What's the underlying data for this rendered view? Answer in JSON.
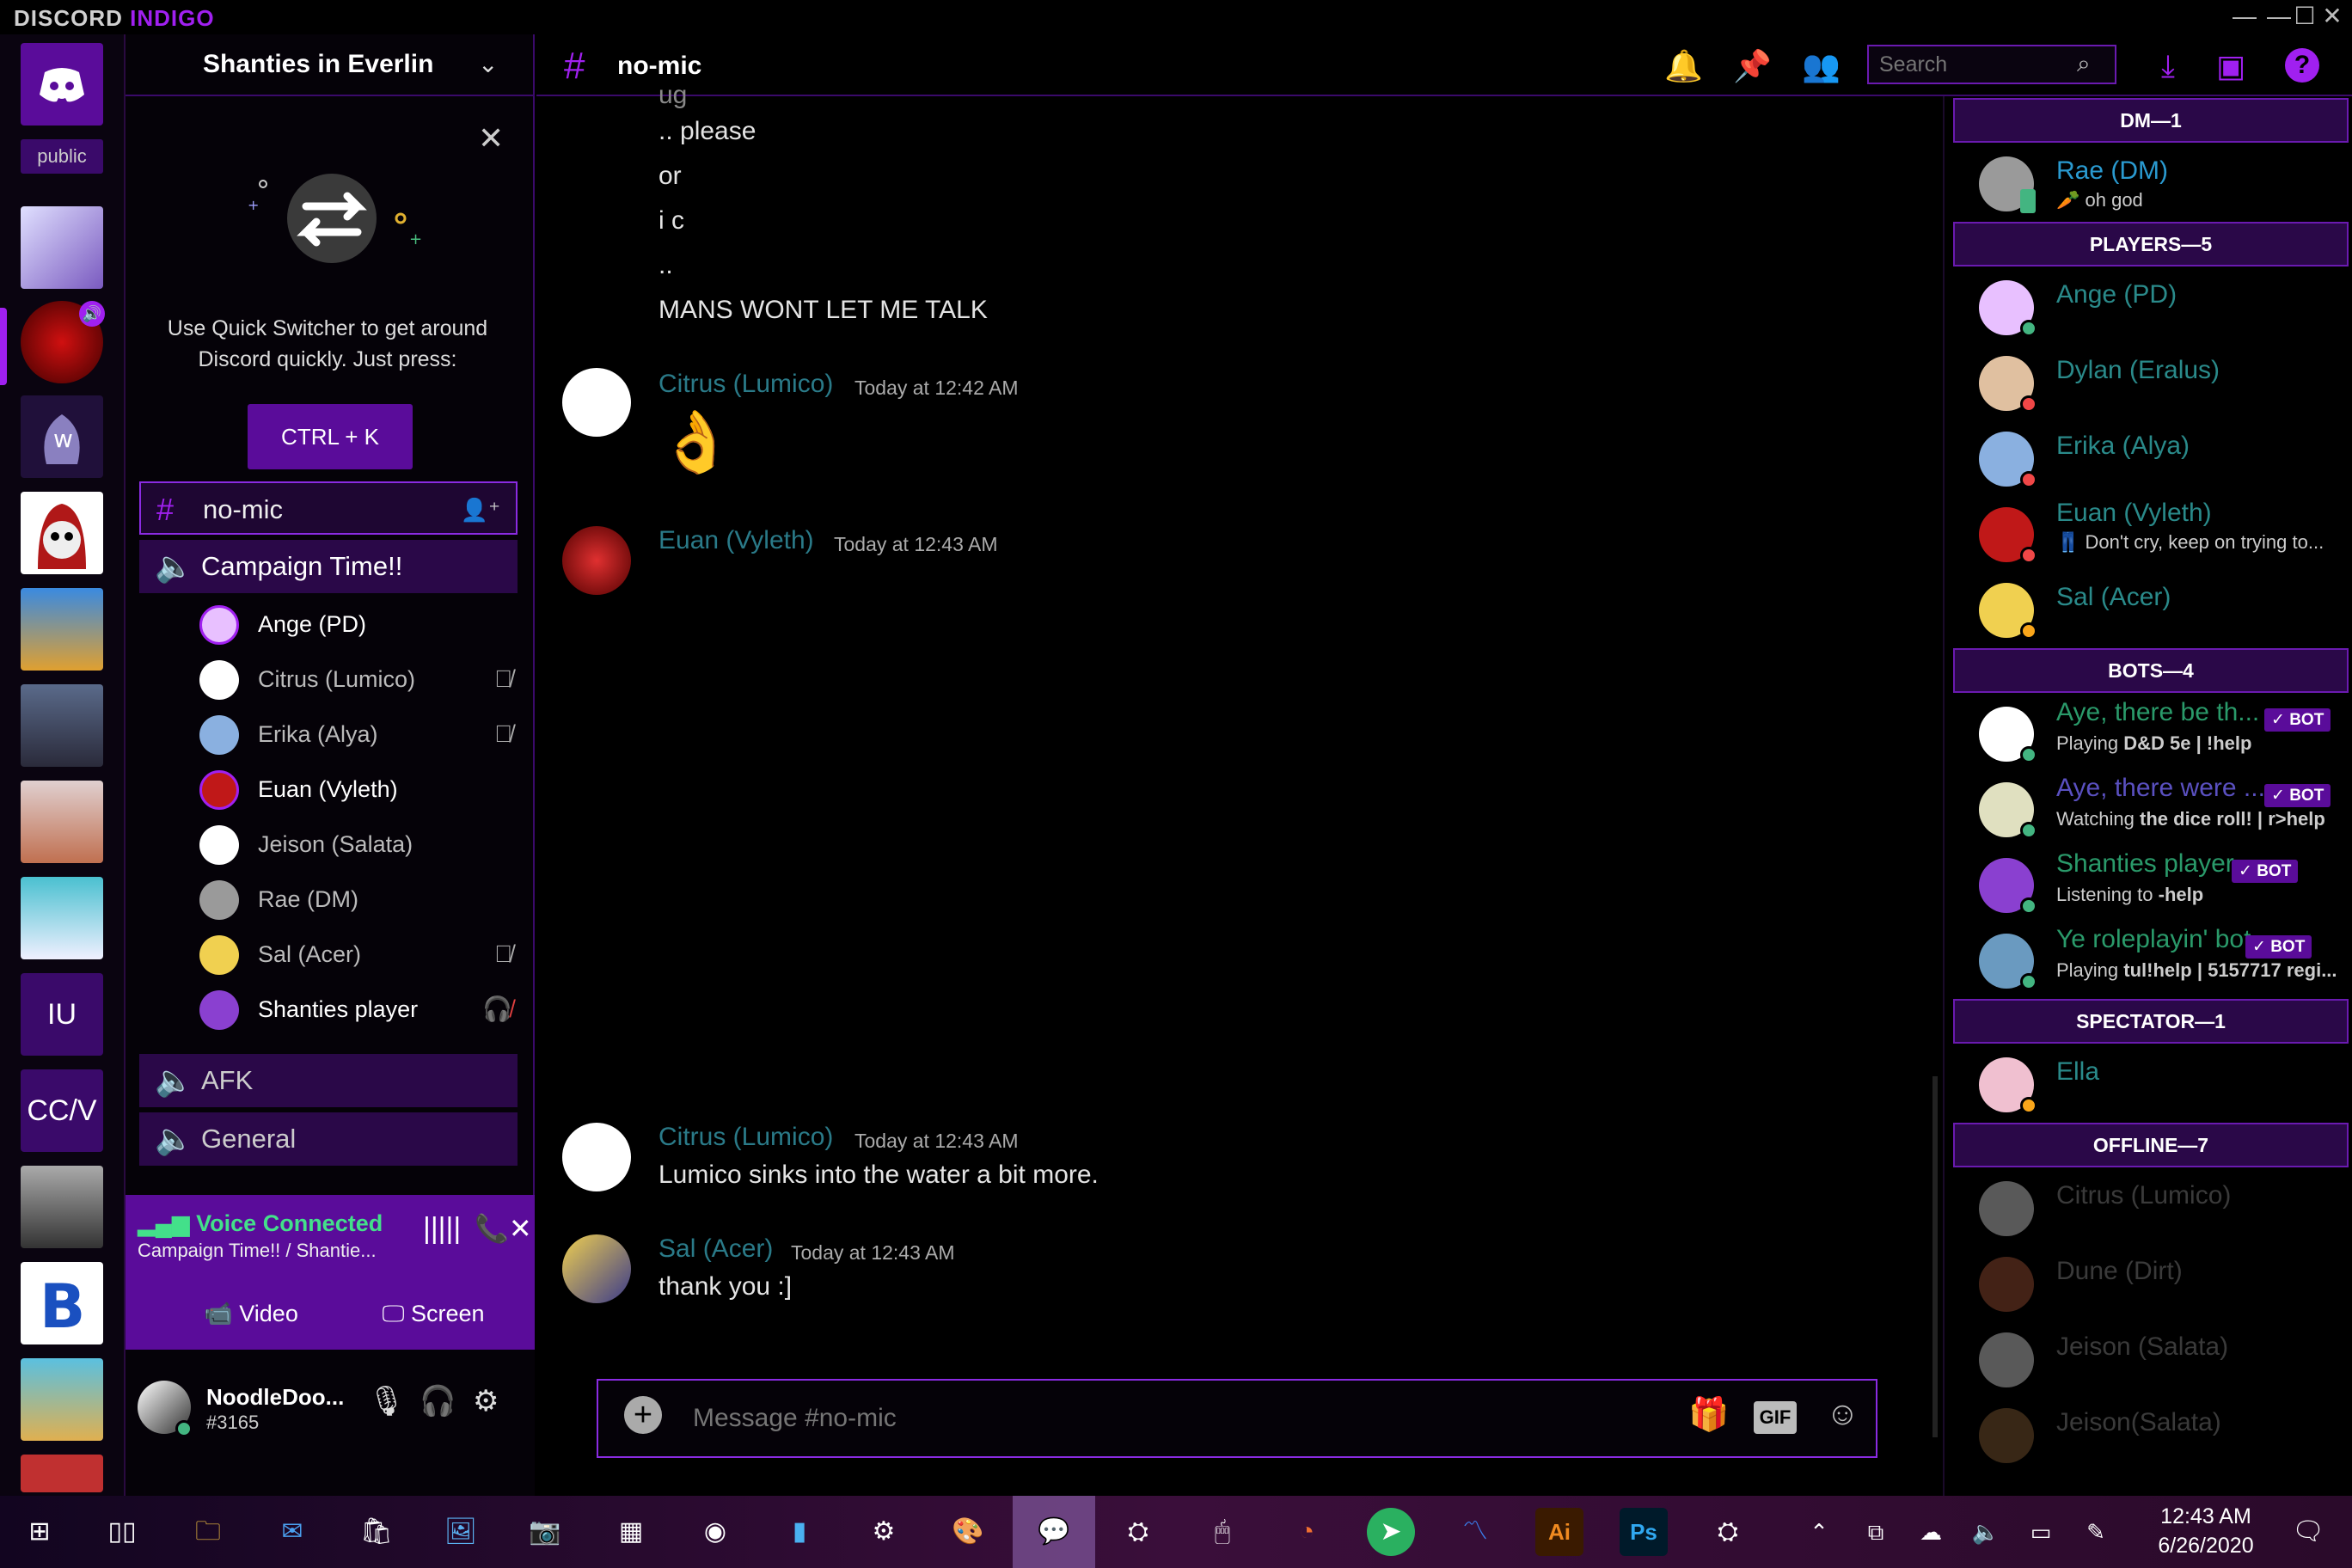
{
  "app": {
    "title_part1": "DISCORD",
    "title_part2": "INDIGO"
  },
  "window": {
    "minimize": "—",
    "maximize": "☐",
    "close": "✕"
  },
  "server_rail": {
    "home_icon": "discord-logo-icon",
    "public_label": "public",
    "text_servers": [
      "IU",
      "CC/V"
    ]
  },
  "guild": {
    "name": "Shanties in Everlin"
  },
  "quick_switcher": {
    "text": "Use Quick Switcher to get around Discord quickly. Just press:",
    "button": "CTRL + K"
  },
  "channels": {
    "text_channel": "no-mic",
    "voice_main": "Campaign Time!!",
    "voice_users": [
      {
        "name": "Ange (PD)",
        "color": "#e8c0ff"
      },
      {
        "name": "Citrus (Lumico)",
        "color": "#ffffff"
      },
      {
        "name": "Erika (Alya)",
        "color": "#8ab0e0"
      },
      {
        "name": "Euan (Vyleth)",
        "color": "#c01818"
      },
      {
        "name": "Jeison (Salata)",
        "color": "#ffffff"
      },
      {
        "name": "Rae (DM)",
        "color": "#9a9a9a"
      },
      {
        "name": "Sal (Acer)",
        "color": "#f0d050"
      },
      {
        "name": "Shanties player",
        "color": "#8a40d0"
      }
    ],
    "voice_afk": "AFK",
    "voice_general": "General"
  },
  "voice_panel": {
    "title": "Voice Connected",
    "subtitle": "Campaign Time!! / Shantie...",
    "video": "Video",
    "screen": "Screen"
  },
  "user": {
    "name": "NoodleDoo...",
    "tag": "#3165"
  },
  "chat": {
    "channel": "no-mic",
    "search_placeholder": "Search",
    "continued_lines": [
      "ug",
      ".. please",
      "or",
      "i c",
      "..",
      "MANS WONT LET ME TALK"
    ],
    "messages": [
      {
        "author": "Citrus (Lumico)",
        "time": "Today at 12:42 AM",
        "content": "👌"
      },
      {
        "author": "Euan (Vyleth)",
        "time": "Today at 12:43 AM",
        "content": ""
      },
      {
        "author": "Citrus (Lumico)",
        "time": "Today at 12:43 AM",
        "content": "Lumico sinks into the water a bit more."
      },
      {
        "author": "Sal (Acer)",
        "time": "Today at 12:43 AM",
        "content": "thank you :]"
      }
    ],
    "composer_placeholder": "Message #no-mic",
    "gif_label": "GIF"
  },
  "members": {
    "groups": {
      "dm": "DM—1",
      "players": "PLAYERS—5",
      "bots": "BOTS—4",
      "spectator": "SPECTATOR—1",
      "offline": "OFFLINE—7"
    },
    "dm": [
      {
        "name": "Rae (DM)",
        "sub": "🥕 oh god",
        "status": "#43b581",
        "name_color": "#2a9ad0"
      }
    ],
    "players": [
      {
        "name": "Ange (PD)",
        "sub": "",
        "status": "#43b581"
      },
      {
        "name": "Dylan (Eralus)",
        "sub": "",
        "status": "#f04747"
      },
      {
        "name": "Erika (Alya)",
        "sub": "",
        "status": "#f04747"
      },
      {
        "name": "Euan (Vyleth)",
        "sub": "👖 Don't cry, keep on trying to...",
        "status": "#f04747"
      },
      {
        "name": "Sal (Acer)",
        "sub": "",
        "status": "#faa61a"
      }
    ],
    "bots": [
      {
        "name": "Aye, there be th...",
        "sub_prefix": "Playing ",
        "sub": "D&D 5e | !help",
        "tag": "✓ BOT",
        "name_color": "#2a9a6a"
      },
      {
        "name": "Aye, there were ...",
        "sub_prefix": "Watching ",
        "sub": "the dice roll! | r>help",
        "tag": "✓ BOT",
        "name_color": "#5a50c0"
      },
      {
        "name": "Shanties player",
        "sub_prefix": "Listening to ",
        "sub": "-help",
        "tag": "✓ BOT",
        "name_color": "#2a9a6a"
      },
      {
        "name": "Ye roleplayin' bot",
        "sub_prefix": "Playing ",
        "sub": "tul!help | 5157717 regi...",
        "tag": "✓ BOT",
        "name_color": "#2a9a6a"
      }
    ],
    "spectator": [
      {
        "name": "Ella",
        "status": "#faa61a"
      }
    ],
    "offline": [
      "Citrus (Lumico)",
      "Dune (Dirt)",
      "Jeison (Salata)",
      "Jeison(Salata)"
    ]
  },
  "taskbar": {
    "time": "12:43 AM",
    "date": "6/26/2020"
  },
  "colors": {
    "accent": "#a020f0",
    "panel": "#5a0c9a",
    "online": "#43b581",
    "dnd": "#f04747",
    "idle": "#faa61a"
  }
}
